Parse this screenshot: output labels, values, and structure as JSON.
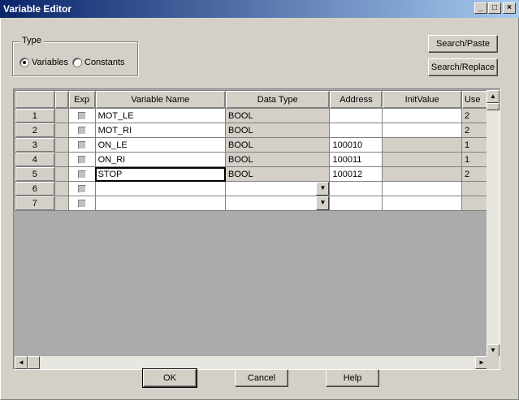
{
  "window": {
    "title": "Variable Editor",
    "minimize": "_",
    "maximize": "□",
    "close": "×"
  },
  "type_group": {
    "legend": "Type",
    "options": [
      {
        "label": "Variables",
        "selected": true
      },
      {
        "label": "Constants",
        "selected": false
      }
    ]
  },
  "buttons": {
    "search_paste": "Search/Paste",
    "search_replace": "Search/Replace",
    "ok": "OK",
    "cancel": "Cancel",
    "help": "Help"
  },
  "table": {
    "headers": [
      "",
      "",
      "Exp",
      "Variable Name",
      "Data Type",
      "Address",
      "InitValue",
      "Use"
    ],
    "rows": [
      {
        "num": "1",
        "name": "MOT_LE",
        "type": "BOOL",
        "address": "",
        "init": "",
        "use": "2"
      },
      {
        "num": "2",
        "name": "MOT_RI",
        "type": "BOOL",
        "address": "",
        "init": "",
        "use": "2"
      },
      {
        "num": "3",
        "name": "ON_LE",
        "type": "BOOL",
        "address": "100010",
        "init": "",
        "use": "1"
      },
      {
        "num": "4",
        "name": "ON_RI",
        "type": "BOOL",
        "address": "100011",
        "init": "",
        "use": "1"
      },
      {
        "num": "5",
        "name": "STOP",
        "type": "BOOL",
        "address": "100012",
        "init": "",
        "use": "2"
      },
      {
        "num": "6",
        "name": "",
        "type": "",
        "address": "",
        "init": "",
        "use": ""
      },
      {
        "num": "7",
        "name": "",
        "type": "",
        "address": "",
        "init": "",
        "use": ""
      }
    ]
  },
  "icons": {
    "dropdown": "▼",
    "up": "▲",
    "down": "▼",
    "left": "◄",
    "right": "►"
  }
}
